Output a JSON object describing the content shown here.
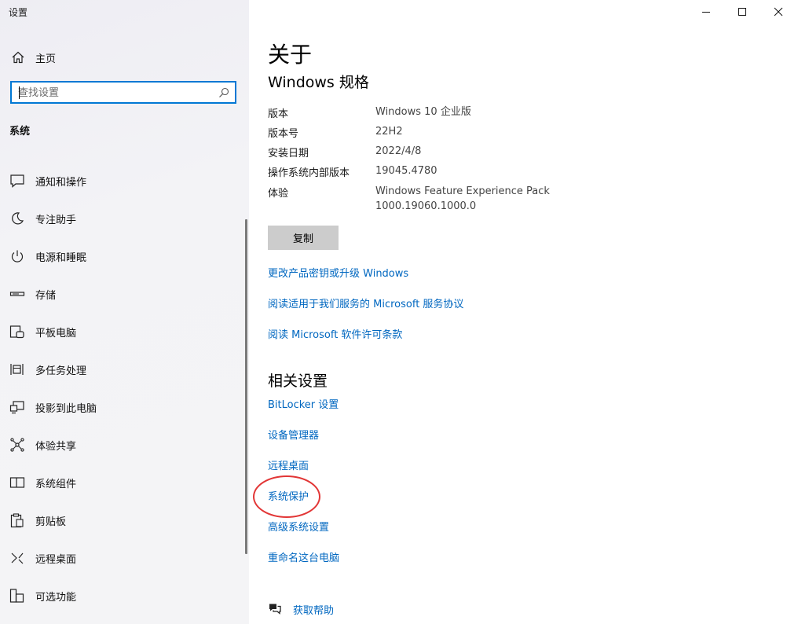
{
  "window": {
    "title": "设置"
  },
  "sidebar": {
    "home_label": "主页",
    "search_placeholder": "查找设置",
    "section_title": "系统",
    "items": [
      {
        "label": "通知和操作",
        "icon": "notification-icon"
      },
      {
        "label": "专注助手",
        "icon": "moon-icon"
      },
      {
        "label": "电源和睡眠",
        "icon": "power-icon"
      },
      {
        "label": "存储",
        "icon": "storage-icon"
      },
      {
        "label": "平板电脑",
        "icon": "tablet-icon"
      },
      {
        "label": "多任务处理",
        "icon": "multitask-icon"
      },
      {
        "label": "投影到此电脑",
        "icon": "project-icon"
      },
      {
        "label": "体验共享",
        "icon": "share-icon"
      },
      {
        "label": "系统组件",
        "icon": "components-icon"
      },
      {
        "label": "剪贴板",
        "icon": "clipboard-icon"
      },
      {
        "label": "远程桌面",
        "icon": "remote-desktop-icon"
      },
      {
        "label": "可选功能",
        "icon": "optional-features-icon"
      }
    ]
  },
  "main": {
    "page_title": "关于",
    "spec_title": "Windows 规格",
    "specs": [
      {
        "label": "版本",
        "value": "Windows 10 企业版"
      },
      {
        "label": "版本号",
        "value": "22H2"
      },
      {
        "label": "安装日期",
        "value": "2022/4/8"
      },
      {
        "label": "操作系统内部版本",
        "value": "19045.4780"
      },
      {
        "label": "体验",
        "value": "Windows Feature Experience Pack",
        "value2": "1000.19060.1000.0"
      }
    ],
    "copy_label": "复制",
    "links": [
      "更改产品密钥或升级 Windows",
      "阅读适用于我们服务的 Microsoft 服务协议",
      "阅读 Microsoft 软件许可条款"
    ],
    "related_title": "相关设置",
    "related_links": [
      "BitLocker 设置",
      "设备管理器",
      "远程桌面",
      "系统保护",
      "高级系统设置",
      "重命名这台电脑"
    ],
    "help_label": "获取帮助"
  },
  "colors": {
    "accent": "#0078d4",
    "link": "#0067c0",
    "annotation": "#e23636"
  }
}
